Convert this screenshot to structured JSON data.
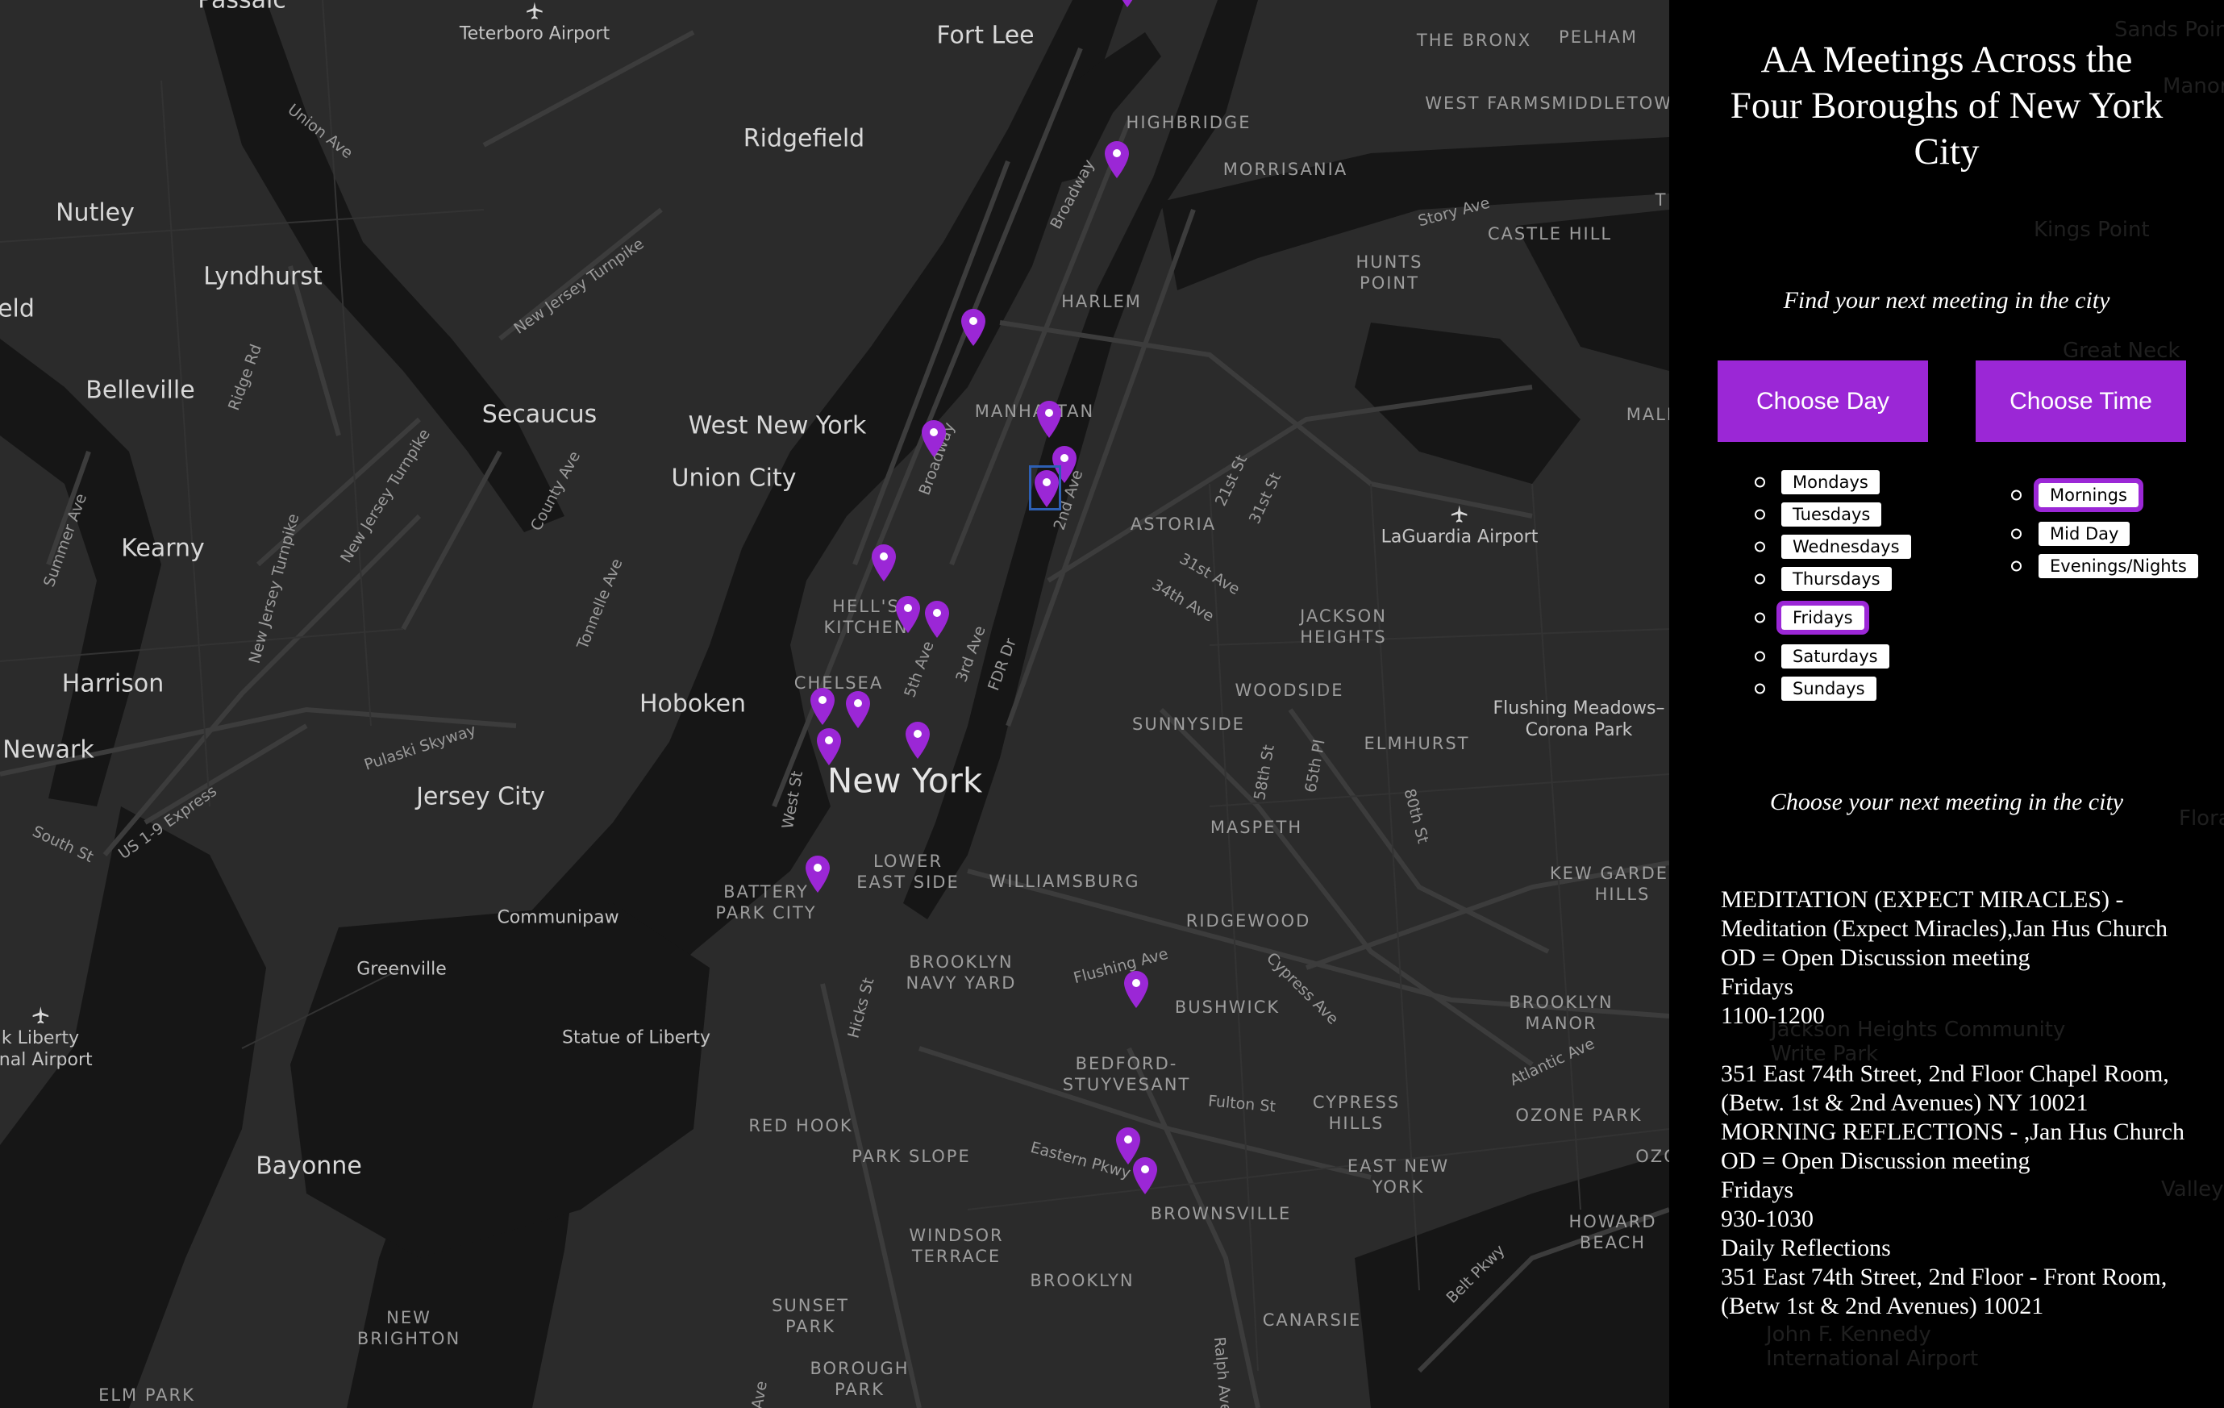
{
  "map": {
    "cities": [
      {
        "name": "Passaic"
      },
      {
        "name": "Fort Lee"
      },
      {
        "name": "Ridgefield"
      },
      {
        "name": "Nutley"
      },
      {
        "name": "Lyndhurst"
      },
      {
        "name": "Belleville"
      },
      {
        "name": "Secaucus"
      },
      {
        "name": "West New York"
      },
      {
        "name": "Union City"
      },
      {
        "name": "Kearny"
      },
      {
        "name": "Harrison"
      },
      {
        "name": "Hoboken"
      },
      {
        "name": "Jersey City"
      },
      {
        "name": "Bayonne"
      },
      {
        "name": "Newark"
      },
      {
        "name": "eld"
      }
    ],
    "main_city": "New York",
    "neighborhoods": [
      {
        "name": "THE BRONX"
      },
      {
        "name": "PELHAM"
      },
      {
        "name": "WEST FARMS"
      },
      {
        "name": "MIDDLETOWN"
      },
      {
        "name": "HIGHBRIDGE"
      },
      {
        "name": "MORRISANIA"
      },
      {
        "name": "HARLEM"
      },
      {
        "name": "HUNTS\nPOINT"
      },
      {
        "name": "CASTLE HILL"
      },
      {
        "name": "MANHATTAN"
      },
      {
        "name": "ASTORIA"
      },
      {
        "name": "JACKSON\nHEIGHTS"
      },
      {
        "name": "HELL'S\nKITCHEN"
      },
      {
        "name": "CHELSEA"
      },
      {
        "name": "WOODSIDE"
      },
      {
        "name": "SUNNYSIDE"
      },
      {
        "name": "ELMHURST"
      },
      {
        "name": "MASPETH"
      },
      {
        "name": "LOWER\nEAST SIDE"
      },
      {
        "name": "BATTERY\nPARK CITY"
      },
      {
        "name": "WILLIAMSBURG"
      },
      {
        "name": "RIDGEWOOD"
      },
      {
        "name": "KEW GARDENS\nHILLS"
      },
      {
        "name": "BROOKLYN\nNAVY YARD"
      },
      {
        "name": "BUSHWICK"
      },
      {
        "name": "BROOKLYN\nMANOR"
      },
      {
        "name": "BEDFORD-\nSTUYVESANT"
      },
      {
        "name": "CYPRESS\nHILLS"
      },
      {
        "name": "OZONE PARK"
      },
      {
        "name": "RED HOOK"
      },
      {
        "name": "PARK SLOPE"
      },
      {
        "name": "EAST NEW\nYORK"
      },
      {
        "name": "BROWNSVILLE"
      },
      {
        "name": "HOWARD\nBEACH"
      },
      {
        "name": "WINDSOR\nTERRACE"
      },
      {
        "name": "BROOKLYN"
      },
      {
        "name": "CANARSIE"
      },
      {
        "name": "SUNSET\nPARK"
      },
      {
        "name": "BOROUGH\nPARK"
      },
      {
        "name": "NEW\nBRIGHTON"
      },
      {
        "name": "ELM PARK"
      },
      {
        "name": "MALB"
      },
      {
        "name": "OZO"
      },
      {
        "name": "T"
      }
    ],
    "roads": [
      {
        "name": "Union Ave"
      },
      {
        "name": "New Jersey Turnpike"
      },
      {
        "name": "Ridge Rd"
      },
      {
        "name": "Broadway"
      },
      {
        "name": "Story Ave"
      },
      {
        "name": "Broadway"
      },
      {
        "name": "2nd Ave"
      },
      {
        "name": "21st St"
      },
      {
        "name": "31st St"
      },
      {
        "name": "31st Ave"
      },
      {
        "name": "34th Ave"
      },
      {
        "name": "New Jersey Turnpike"
      },
      {
        "name": "County Ave"
      },
      {
        "name": "Summer Ave"
      },
      {
        "name": "Tonnelle Ave"
      },
      {
        "name": "5th Ave"
      },
      {
        "name": "3rd Ave"
      },
      {
        "name": "FDR Dr"
      },
      {
        "name": "58th St"
      },
      {
        "name": "65th Pl"
      },
      {
        "name": "80th St"
      },
      {
        "name": "New Jersey Turnpike"
      },
      {
        "name": "Pulaski Skyway"
      },
      {
        "name": "US 1-9 Express"
      },
      {
        "name": "South St"
      },
      {
        "name": "West St"
      },
      {
        "name": "Flushing Ave"
      },
      {
        "name": "Cypress Ave"
      },
      {
        "name": "Atlantic Ave"
      },
      {
        "name": "Hicks St"
      },
      {
        "name": "Fulton St"
      },
      {
        "name": "Eastern Pkwy"
      },
      {
        "name": "Belt Pkwy"
      },
      {
        "name": "Ralph Ave"
      },
      {
        "name": "Ave"
      }
    ],
    "pois": [
      {
        "name": "Teterboro Airport"
      },
      {
        "name": "LaGuardia Airport"
      },
      {
        "name": "Flushing Meadows–\nCorona Park"
      },
      {
        "name": "Communipaw"
      },
      {
        "name": "Greenville"
      },
      {
        "name": "Statue of Liberty"
      },
      {
        "name": "k Liberty\nonal Airport"
      }
    ],
    "marker_count": 21,
    "selected_marker": 6
  },
  "panel": {
    "title_lines": [
      "AA Meetings Across the",
      "Four Boroughs of New York",
      "City"
    ],
    "find_heading": "Find your next meeting in the city",
    "choose_day_label": "Choose Day",
    "choose_time_label": "Choose Time",
    "days": [
      "Mondays",
      "Tuesdays",
      "Wednesdays",
      "Thursdays",
      "Fridays",
      "Saturdays",
      "Sundays"
    ],
    "selected_day": "Fridays",
    "times": [
      "Mornings",
      "Mid Day",
      "Evenings/Nights"
    ],
    "selected_time": "Mornings",
    "choose_heading": "Choose your next meeting in the city",
    "results": [
      "MEDITATION (EXPECT MIRACLES) -",
      "Meditation (Expect Miracles),Jan Hus Church",
      "OD = Open Discussion meeting",
      "Fridays",
      "1100-1200",
      "",
      "351 East 74th Street, 2nd Floor Chapel Room,",
      "(Betw. 1st & 2nd Avenues) NY 10021",
      "MORNING REFLECTIONS - ,Jan Hus Church",
      "OD = Open Discussion meeting",
      "Fridays",
      "930-1030",
      "Daily Reflections",
      "351 East 74th Street, 2nd Floor - Front Room,",
      "(Betw 1st & 2nd Avenues) 10021"
    ],
    "ghost_labels": [
      "Sands Point",
      "Manorhaven",
      "Kings Point",
      "Great Neck",
      "Flora",
      "Valley Stream",
      "John F. Kennedy\nInternational Airport",
      "Jackson Heights Community\nWrite Park"
    ]
  },
  "colors": {
    "accent": "#9b27d6",
    "map_land": "#2b2b2b",
    "map_water": "#161616",
    "selection_box": "#2d5fb3",
    "panel_bg": "#000000"
  }
}
